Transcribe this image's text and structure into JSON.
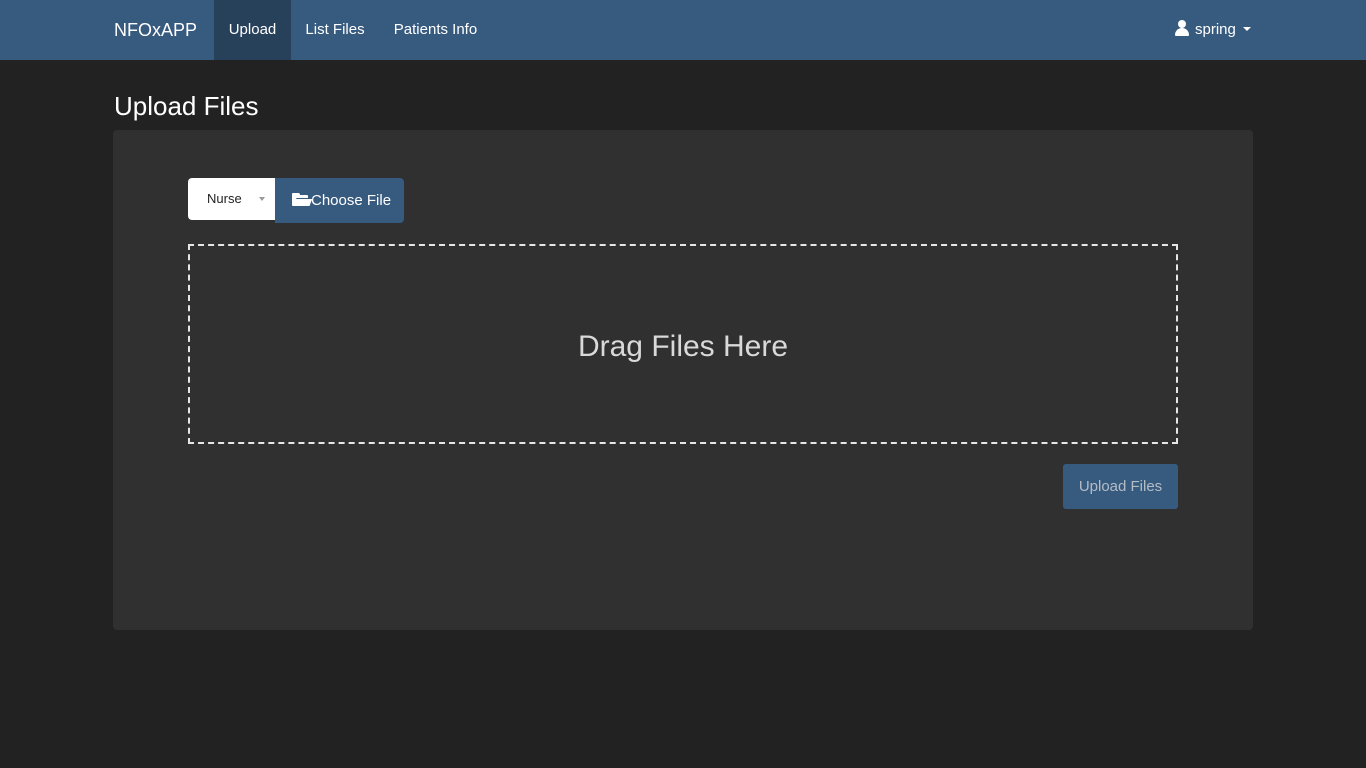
{
  "navbar": {
    "brand": "NFOxAPP",
    "items": [
      {
        "label": "Upload",
        "active": true
      },
      {
        "label": "List Files",
        "active": false
      },
      {
        "label": "Patients Info",
        "active": false
      }
    ],
    "user": {
      "name": "spring",
      "icon": "user-icon"
    }
  },
  "page": {
    "title": "Upload Files"
  },
  "upload_form": {
    "role_select": {
      "selected": "Nurse"
    },
    "choose_file": {
      "label": "Choose File",
      "icon": "folder-open-icon"
    },
    "dropzone": {
      "text": "Drag Files Here"
    },
    "submit": {
      "label": "Upload Files",
      "disabled": true
    }
  },
  "colors": {
    "navbar": "#375a7f",
    "nav_active": "#28415b",
    "page_background": "#222222",
    "panel_background": "#303030",
    "button_primary": "#375a7f"
  }
}
